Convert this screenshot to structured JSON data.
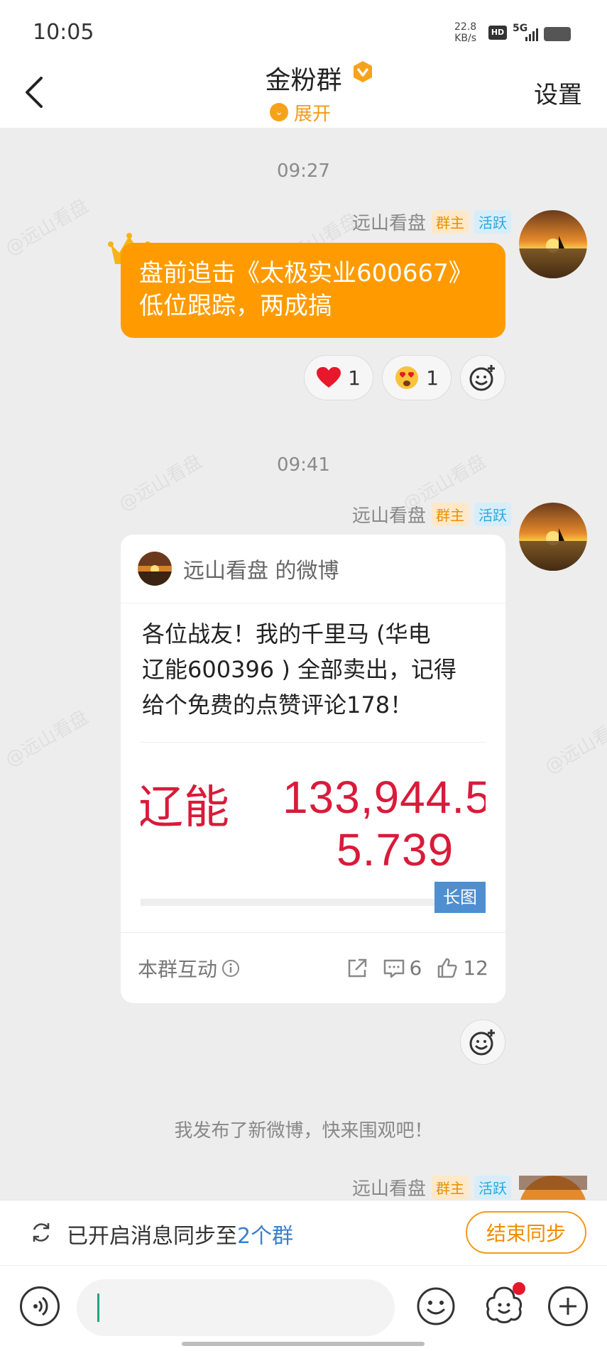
{
  "status": {
    "time": "10:05",
    "net_speed_value": "22.8",
    "net_speed_unit": "KB/s",
    "hd": "HD",
    "network": "5G"
  },
  "header": {
    "title": "金粉群",
    "expand_label": "展开",
    "settings_label": "设置"
  },
  "watermark_text": "@远山看盘",
  "messages": [
    {
      "time": "09:27",
      "sender": "远山看盘",
      "tag_owner": "群主",
      "tag_active": "活跃",
      "text_line1": "盘前追击《太极实业600667》",
      "text_line2": "低位跟踪，两成搞",
      "reactions": [
        {
          "emoji": "heart-icon",
          "count": "1"
        },
        {
          "emoji": "heart-eyes-icon",
          "count": "1"
        }
      ]
    },
    {
      "time": "09:41",
      "sender": "远山看盘",
      "tag_owner": "群主",
      "tag_active": "活跃",
      "card": {
        "author": "远山看盘 的微博",
        "text_line1": "各位战友！我的千里马 (华电",
        "text_line2": "辽能600396 ) 全部卖出，记得",
        "text_line3": "给个免费的点赞评论178！",
        "image_text_left": "辽能",
        "image_text_value1": "133,944.5",
        "image_text_value2": "5.739",
        "long_image_label": "长图",
        "interaction_label": "本群互动",
        "comments": "6",
        "likes": "12"
      }
    }
  ],
  "system_message": "我发布了新微博，快来围观吧！",
  "third_sender": {
    "name": "远山看盘",
    "tag_owner": "群主",
    "tag_active": "活跃"
  },
  "sync": {
    "text": "已开启消息同步至",
    "link": "2个群",
    "end_button": "结束同步"
  },
  "colors": {
    "accent": "#ff9b00",
    "link": "#3a7fd0",
    "owner_tag": "#f08c00",
    "active_tag": "#2aa7e0"
  }
}
